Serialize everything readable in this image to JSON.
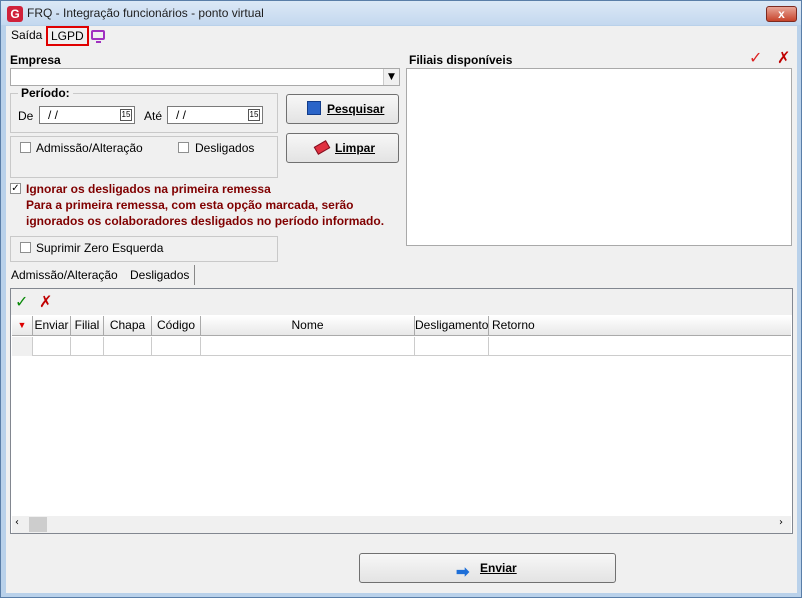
{
  "window": {
    "title": "FRQ - Integração funcionários - ponto virtual",
    "close_label": "x",
    "app_icon": "G"
  },
  "menu": {
    "saida": "Saída",
    "lgpd": "LGPD"
  },
  "empresa": {
    "label": "Empresa",
    "value": ""
  },
  "periodo": {
    "label": "Período:",
    "de_label": "De",
    "de_value": "/ /",
    "ate_label": "Até",
    "ate_value": "/ /",
    "cal_glyph": "15"
  },
  "buttons": {
    "pesquisar": "Pesquisar",
    "limpar": "Limpar",
    "enviar": "Enviar"
  },
  "filters": {
    "admissao": "Admissão/Alteração",
    "admissao_checked": false,
    "desligados": "Desligados",
    "desligados_checked": false
  },
  "ignore": {
    "label": "Ignorar os desligados na primeira remessa",
    "checked": true,
    "note_line1": "Para a primeira remessa, com esta opção marcada, serão",
    "note_line2": "ignorados os colaboradores desligados no período informado."
  },
  "suprimir": {
    "label": "Suprimir Zero Esquerda",
    "checked": false
  },
  "filiais": {
    "label": "Filiais disponíveis"
  },
  "tabs": [
    {
      "label": "Admissão/Alteração"
    },
    {
      "label": "Desligados"
    }
  ],
  "grid": {
    "columns": [
      "Enviar",
      "Filial",
      "Chapa",
      "Código",
      "Nome",
      "Desligamento",
      "Retorno"
    ]
  },
  "colors": {
    "check": "#0a8a0a",
    "cross": "#c00000",
    "warn_text": "#800000",
    "lgpd_border": "#e00000"
  },
  "icons": {
    "accept": "check-icon",
    "reject": "x-icon",
    "save": "floppy-icon",
    "clear": "eraser-icon",
    "send": "arrow-right-icon"
  }
}
